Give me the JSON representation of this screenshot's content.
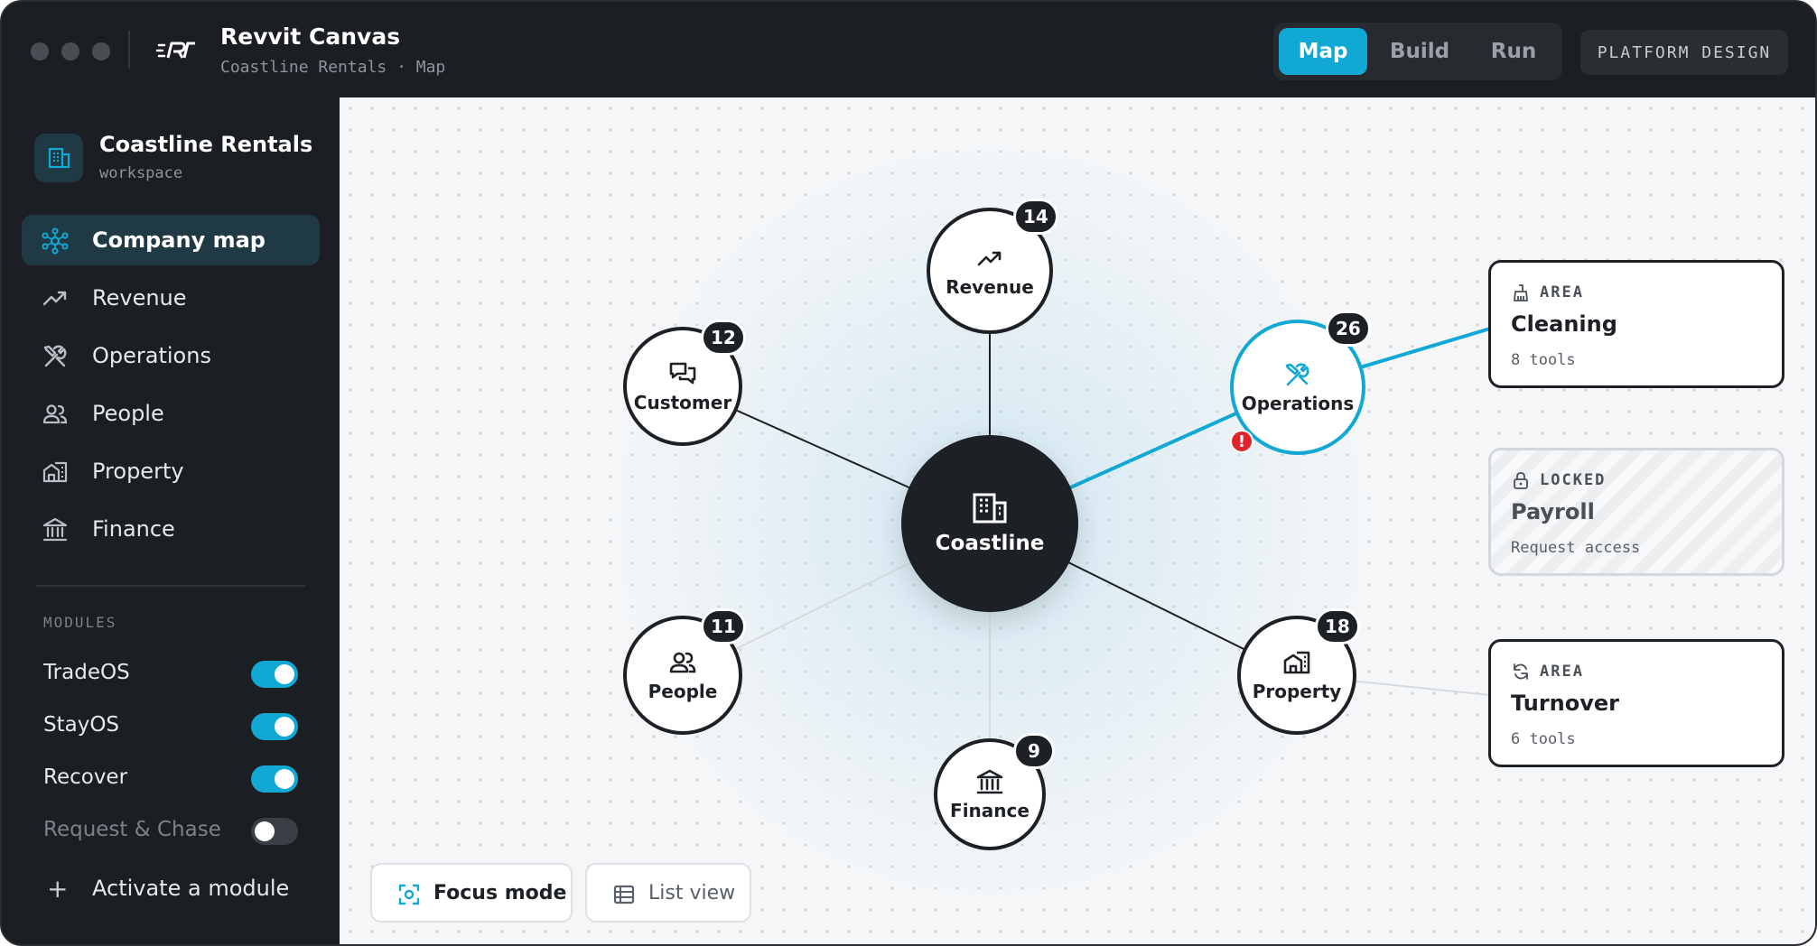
{
  "app": {
    "title": "Revvit Canvas",
    "breadcrumb": "Coastline Rentals · Map"
  },
  "header": {
    "tabs": [
      {
        "label": "Map",
        "active": true
      },
      {
        "label": "Build",
        "active": false
      },
      {
        "label": "Run",
        "active": false
      }
    ],
    "platform_label": "PLATFORM DESIGN"
  },
  "sidebar": {
    "workspace": {
      "name": "Coastline Rentals",
      "subtitle": "workspace"
    },
    "nav": [
      {
        "label": "Company map",
        "icon": "company-map-icon",
        "active": true
      },
      {
        "label": "Revenue",
        "icon": "trend-up-icon",
        "active": false
      },
      {
        "label": "Operations",
        "icon": "tools-icon",
        "active": false
      },
      {
        "label": "People",
        "icon": "people-icon",
        "active": false
      },
      {
        "label": "Property",
        "icon": "property-icon",
        "active": false
      },
      {
        "label": "Finance",
        "icon": "bank-icon",
        "active": false
      }
    ],
    "modules_heading": "MODULES",
    "modules": [
      {
        "label": "TradeOS",
        "enabled": true
      },
      {
        "label": "StayOS",
        "enabled": true
      },
      {
        "label": "Recover",
        "enabled": true
      },
      {
        "label": "Request & Chase",
        "enabled": false
      }
    ],
    "activate_label": "Activate a module"
  },
  "map": {
    "center": {
      "label": "Coastline",
      "icon": "building-icon"
    },
    "nodes": [
      {
        "label": "Revenue",
        "count": "14",
        "icon": "trend-up-icon"
      },
      {
        "label": "Customer",
        "count": "12",
        "icon": "chat-icon"
      },
      {
        "label": "Operations",
        "count": "26",
        "icon": "tools-icon",
        "selected": true,
        "warning": "!"
      },
      {
        "label": "People",
        "count": "11",
        "icon": "people-icon"
      },
      {
        "label": "Property",
        "count": "18",
        "icon": "property-icon"
      },
      {
        "label": "Finance",
        "count": "9",
        "icon": "bank-icon"
      }
    ],
    "cards": [
      {
        "tag": "AREA",
        "title": "Cleaning",
        "subtitle": "8 tools",
        "icon": "broom-icon"
      },
      {
        "tag": "LOCKED",
        "title": "Payroll",
        "subtitle": "Request access",
        "icon": "lock-icon"
      },
      {
        "tag": "AREA",
        "title": "Turnover",
        "subtitle": "6 tools",
        "icon": "refresh-icon"
      }
    ],
    "focus_label": "Focus mode",
    "list_label": "List view"
  },
  "colors": {
    "accent": "#12a8d4",
    "dark": "#1d2025",
    "warning": "#e0242b"
  }
}
